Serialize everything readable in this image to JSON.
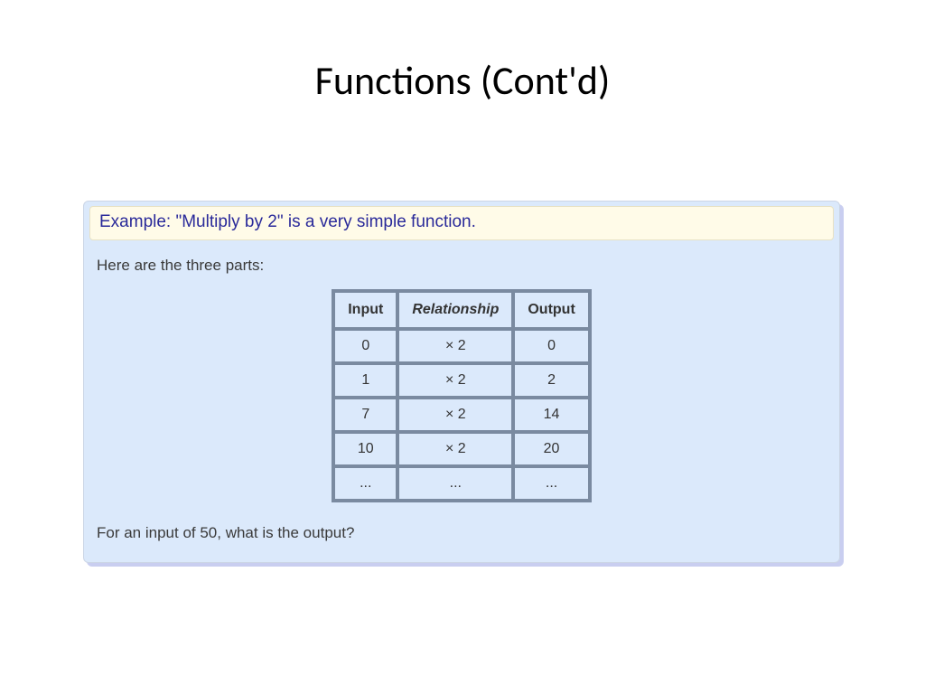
{
  "title": "Functions (Cont'd)",
  "example_text": "Example: \"Multiply by 2\" is a very simple function.",
  "intro_text": "Here are the three parts:",
  "table": {
    "headers": {
      "col1": "Input",
      "col2": "Relationship",
      "col3": "Output"
    },
    "rows": [
      {
        "input": "0",
        "rel": "× 2",
        "output": "0"
      },
      {
        "input": "1",
        "rel": "× 2",
        "output": "2"
      },
      {
        "input": "7",
        "rel": "× 2",
        "output": "14"
      },
      {
        "input": "10",
        "rel": "× 2",
        "output": "20"
      },
      {
        "input": "...",
        "rel": "...",
        "output": "..."
      }
    ]
  },
  "question_text": "For an input of 50, what is the output?"
}
